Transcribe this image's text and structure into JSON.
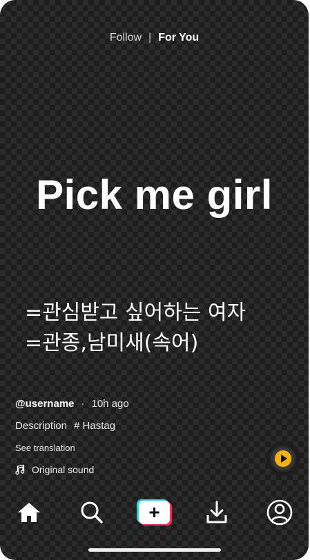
{
  "top_nav": {
    "follow": "Follow",
    "separator": "|",
    "for_you": "For You"
  },
  "video": {
    "title": "Pick me girl",
    "line1": "=관심받고 싶어하는 여자",
    "line2": "=관종,남미새(속어)"
  },
  "meta": {
    "username": "@username",
    "dot": "·",
    "time": "10h ago",
    "description": "Description",
    "hashtag": "# Hastag",
    "see_translation": "See translation",
    "sound": "Original sound"
  },
  "colors": {
    "accent_cyan": "#25d7e0",
    "accent_red": "#fe2c55",
    "disc_play": "#f6b10f"
  },
  "tabbar": {
    "home_icon": "home-icon",
    "search_icon": "search-icon",
    "create_label": "+",
    "download_icon": "download-icon",
    "profile_icon": "profile-icon"
  }
}
